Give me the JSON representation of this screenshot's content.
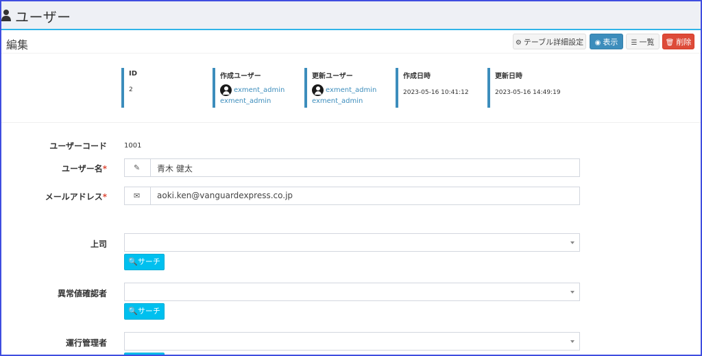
{
  "header": {
    "title": "ユーザー",
    "icon": "user-icon"
  },
  "box": {
    "title": "編集"
  },
  "toolbar": {
    "table_settings": "テーブル詳細設定",
    "view": "表示",
    "list": "一覧",
    "delete": "削除"
  },
  "info": {
    "id": {
      "label": "ID",
      "value": "2"
    },
    "created_by": {
      "label": "作成ユーザー",
      "user": "exment_admin",
      "user2": "exment_admin"
    },
    "updated_by": {
      "label": "更新ユーザー",
      "user": "exment_admin",
      "user2": "exment_admin"
    },
    "created_at": {
      "label": "作成日時",
      "value": "2023-05-16 10:41:12"
    },
    "updated_at": {
      "label": "更新日時",
      "value": "2023-05-16 14:49:19"
    }
  },
  "form": {
    "user_code": {
      "label": "ユーザーコード",
      "value": "1001"
    },
    "user_name": {
      "label": "ユーザー名",
      "required": "*",
      "value": "青木 健太"
    },
    "email": {
      "label": "メールアドレス",
      "required": "*",
      "value": "aoki.ken@vanguardexpress.co.jp"
    },
    "boss": {
      "label": "上司",
      "value": ""
    },
    "anomaly_approver": {
      "label": "異常値確認者",
      "value": ""
    },
    "operation_manager": {
      "label": "運行管理者",
      "value": ""
    },
    "search_label": "サーチ"
  },
  "colors": {
    "accent": "#3c8dbc",
    "danger": "#dd4b39",
    "search": "#00c0ef",
    "header_line": "#2fb4e8",
    "frame": "#3f4de0"
  }
}
